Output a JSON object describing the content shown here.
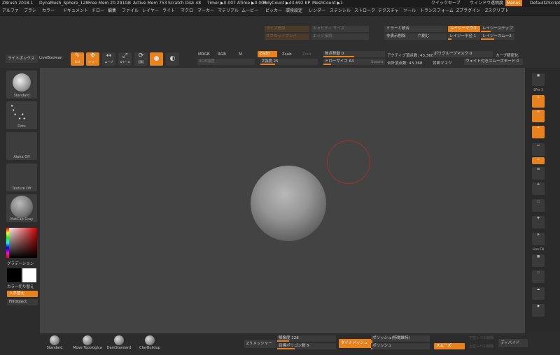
{
  "titlebar": {
    "app": "ZBrush 2018.1",
    "doc": "DynaMesh_Sphere_128",
    "free_mem": "Free Mem 20.291GB",
    "active_mem": "Active Mem 753",
    "scratch": "Scratch Disk 48",
    "timer": "Timer ▶0.007 ATime ▶0.004",
    "polycount": "PolyCount ▶43.692 KP",
    "meshcount": "MeshCount ▶1",
    "quicksave": "クイックセーブ",
    "transparency": "ウィンドウ透明度",
    "menus": "Menus",
    "defaultscript": "DefaultZScript"
  },
  "menu": [
    "アルファ",
    "ブラシ",
    "カラー",
    "ドキュメント",
    "ドロー",
    "編集",
    "ファイル",
    "レイヤー",
    "ライト",
    "マクロ",
    "マーカー",
    "マテリアル",
    "ムービー",
    "ピッカー",
    "環境設定",
    "レンダー",
    "ステンシル",
    "ストローク",
    "テクスチャ",
    "ツール",
    "トランスフォーム",
    "Zプラグイン",
    "Zスクリプト"
  ],
  "top": {
    "lightbox": "ライトボックス",
    "liveboolean": "LiveBoolean",
    "tools": [
      {
        "icon": "✎",
        "label": "Edit"
      },
      {
        "icon": "✥",
        "label": "ドロー"
      },
      {
        "icon": "↔",
        "label": "ムーブ"
      },
      {
        "icon": "⤢",
        "label": "スケール"
      },
      {
        "icon": "⟳",
        "label": "回転"
      }
    ],
    "mrgb": "MRGB",
    "rgb": "RGB",
    "m": "M",
    "zadd": "Zadd",
    "zsub": "Zsub",
    "zcut": "Zcut",
    "rgb_intensity": "RGB強度",
    "z_intensity": "Z強度 25",
    "focal_shift": "焦点移動 0",
    "draw_size": "ドローサイズ 64",
    "dynamic": "Dynamic",
    "active_points": "アクティブ頂点数: 43,368",
    "total_points": "合計頂点数: 43,368",
    "polygroup_mask": "ポリグループマスク 0",
    "backface_mask": "背面マスク",
    "curve_precision": "カーブ精密化",
    "weighted_smooth": "ウェイト付きスムーズモード 0",
    "adjust_btn": "ライズ追加",
    "offset_btn": "オフセットプレイ",
    "cavity_size": "キャビティ サイズ",
    "edge_loop": "エッジ接続",
    "mirror_weld": "ミラーと統合",
    "del_hidden": "非表示削除",
    "close_holes": "穴閉じ",
    "lazy_mouse": "レイジーマウス",
    "lazy_radius": "レイジー半径 1",
    "lazy_step": "レイジーステップ",
    "lazy_smooth": "レイジースムー2"
  },
  "left": {
    "brush_label": "Standard",
    "stroke_label": "Dots",
    "alpha_label": "Alpha Off",
    "texture_label": "Texture Off",
    "material_label": "MatCap Gray",
    "gradient": "グラデーション",
    "switch_color": "カラー切り替え",
    "swap": "入れ替え",
    "fill_object": "FillObject"
  },
  "right": {
    "spix": "SPix 3",
    "tools": [
      "",
      "ズーム",
      "移動",
      "回転",
      "ポリF",
      "透明",
      "ゴースト",
      "ソロ",
      "Xpose"
    ],
    "floor": "Floor",
    "local": "Local",
    "linefill": "Line Fill",
    "poly": "PolyF"
  },
  "bottom": {
    "brushes": [
      "Standard",
      "Move Topologica",
      "DamStandard",
      "ClayBuildup"
    ],
    "zremesher": "Zリメッシャー",
    "resolution": "解像度 128",
    "target_polys": "目標ポリゴン数 5",
    "dynamesh": "ダイナメッシュ",
    "polish_features": "ポリッシュ(特徴維持)",
    "polish": "ポリッシュ",
    "smooth": "スムーズ",
    "divide": "ディバイド",
    "lower_res": "下位レベル削除",
    "higher_res": "上位レベル削除"
  },
  "colors": {
    "accent": "#e8821e",
    "bg": "#2b2b2b",
    "canvas": "#434343"
  }
}
